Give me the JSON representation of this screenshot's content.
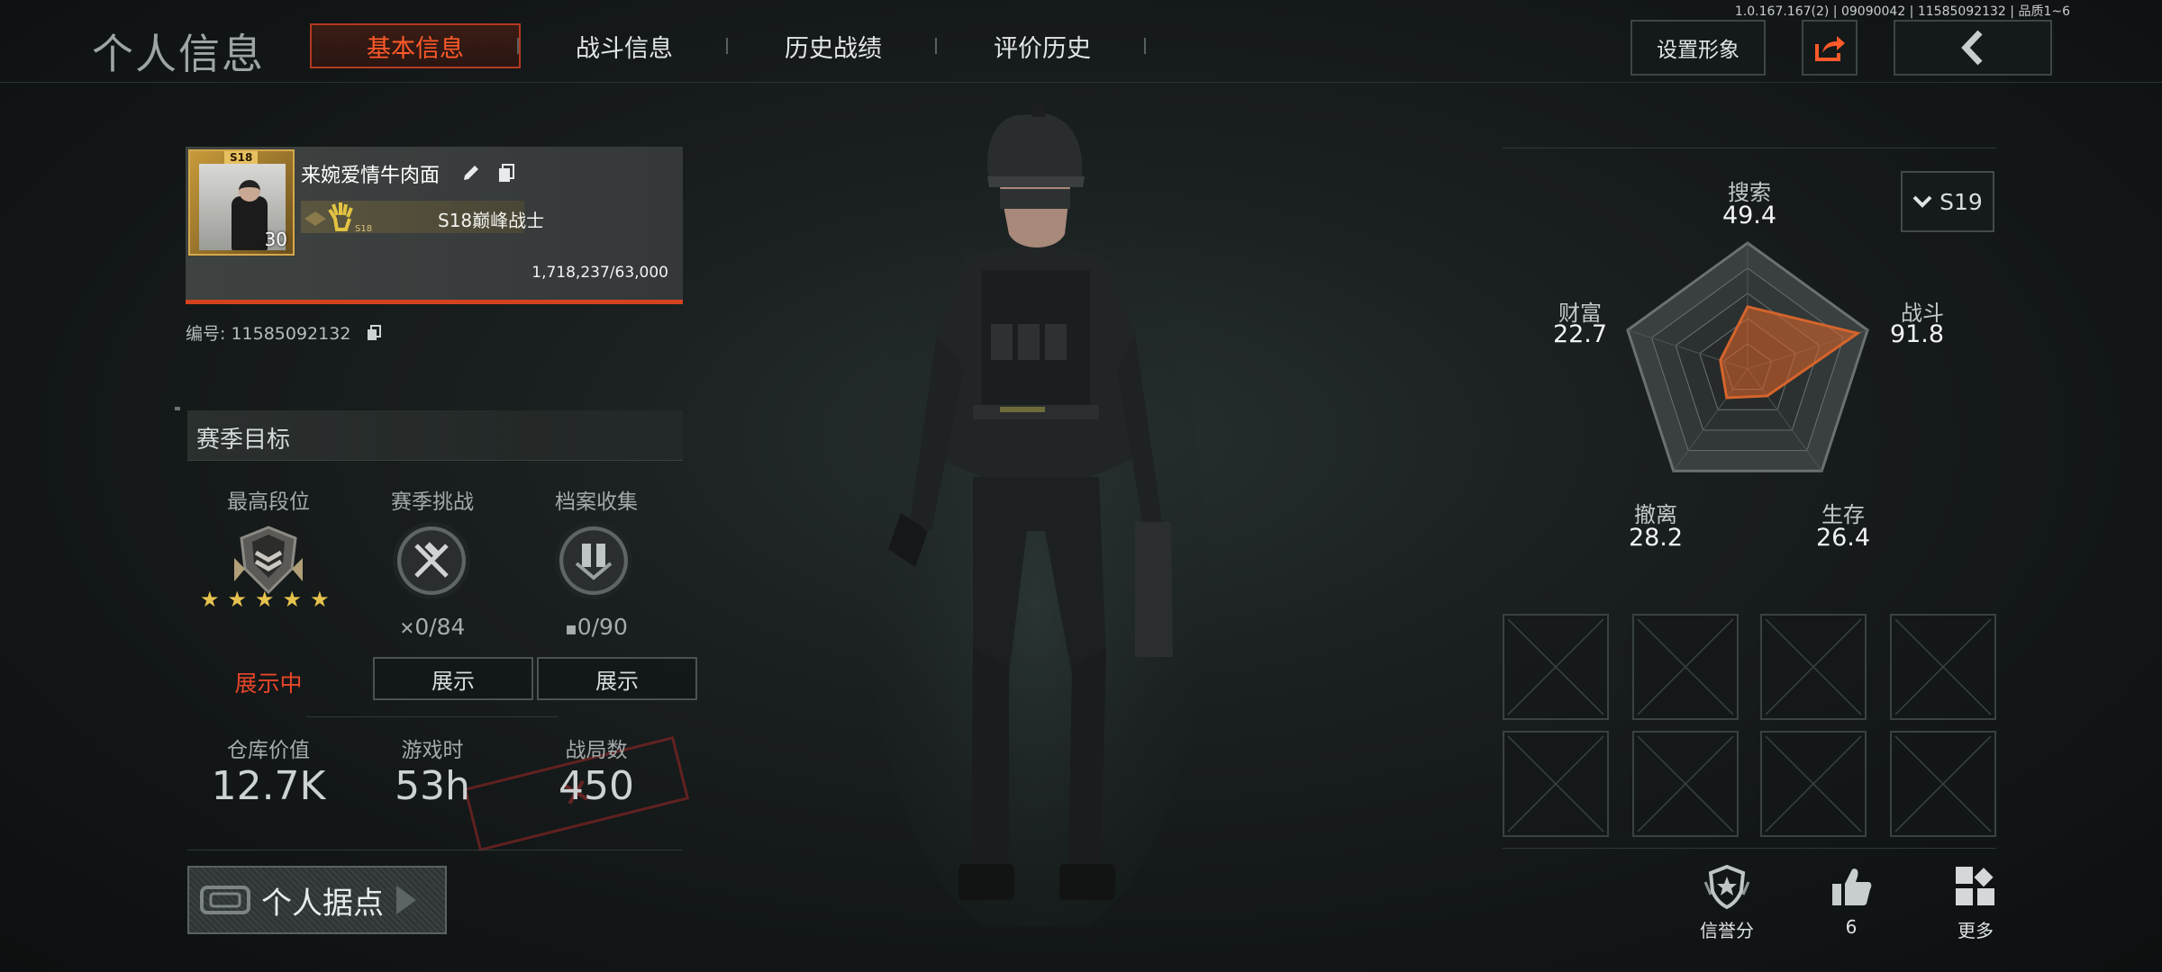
{
  "header": {
    "title": "个人信息",
    "tabs": [
      {
        "label": "基本信息",
        "active": true
      },
      {
        "label": "战斗信息",
        "active": false
      },
      {
        "label": "历史战绩",
        "active": false
      },
      {
        "label": "评价历史",
        "active": false
      }
    ],
    "version": "1.0.167.167(2) | 09090042 | 11585092132 | 品质1~6",
    "set_appearance_label": "设置形象",
    "share_icon": "share-icon",
    "back_icon": "back-arrow-icon"
  },
  "profile": {
    "avatar_tag": "S18",
    "level": "30",
    "nickname": "来婉爱情牛肉面",
    "rank_title": "S18巅峰战士",
    "rank_badge_text": "S18",
    "exp": "1,718,237/63,000",
    "uid_label": "编号: 11585092132"
  },
  "season_goals": {
    "title": "赛季目标",
    "items": [
      {
        "label": "最高段位",
        "icon": "rank-badge-icon",
        "stars": "★★★★★",
        "status": "展示中"
      },
      {
        "label": "赛季挑战",
        "icon": "crossed-guns-icon",
        "count": "0/84",
        "button": "展示"
      },
      {
        "label": "档案收集",
        "icon": "archive-icon",
        "count": "0/90",
        "button": "展示"
      }
    ]
  },
  "stats": [
    {
      "label": "仓库价值",
      "value": "12.7K"
    },
    {
      "label": "游戏时",
      "value": "53h"
    },
    {
      "label": "战局数",
      "value": "450"
    }
  ],
  "personal_base": {
    "label": "个人据点"
  },
  "season_selector": {
    "value": "S19"
  },
  "radar": {
    "axes": [
      {
        "label": "搜索",
        "value": "49.4",
        "score": 49.4
      },
      {
        "label": "战斗",
        "value": "91.8",
        "score": 91.8
      },
      {
        "label": "生存",
        "value": "26.4",
        "score": 26.4
      },
      {
        "label": "撤离",
        "value": "28.2",
        "score": 28.2
      },
      {
        "label": "财富",
        "value": "22.7",
        "score": 22.7
      }
    ],
    "fill_color": "#d4642c",
    "max": 100
  },
  "bottom_actions": [
    {
      "label": "信誉分",
      "icon": "credit-shield-icon"
    },
    {
      "label": "6",
      "icon": "thumbs-up-icon"
    },
    {
      "label": "更多",
      "icon": "more-grid-icon"
    }
  ],
  "colors": {
    "accent": "#ff5a2a",
    "tab_border": "#b23a1f",
    "star": "#e6c24e"
  }
}
